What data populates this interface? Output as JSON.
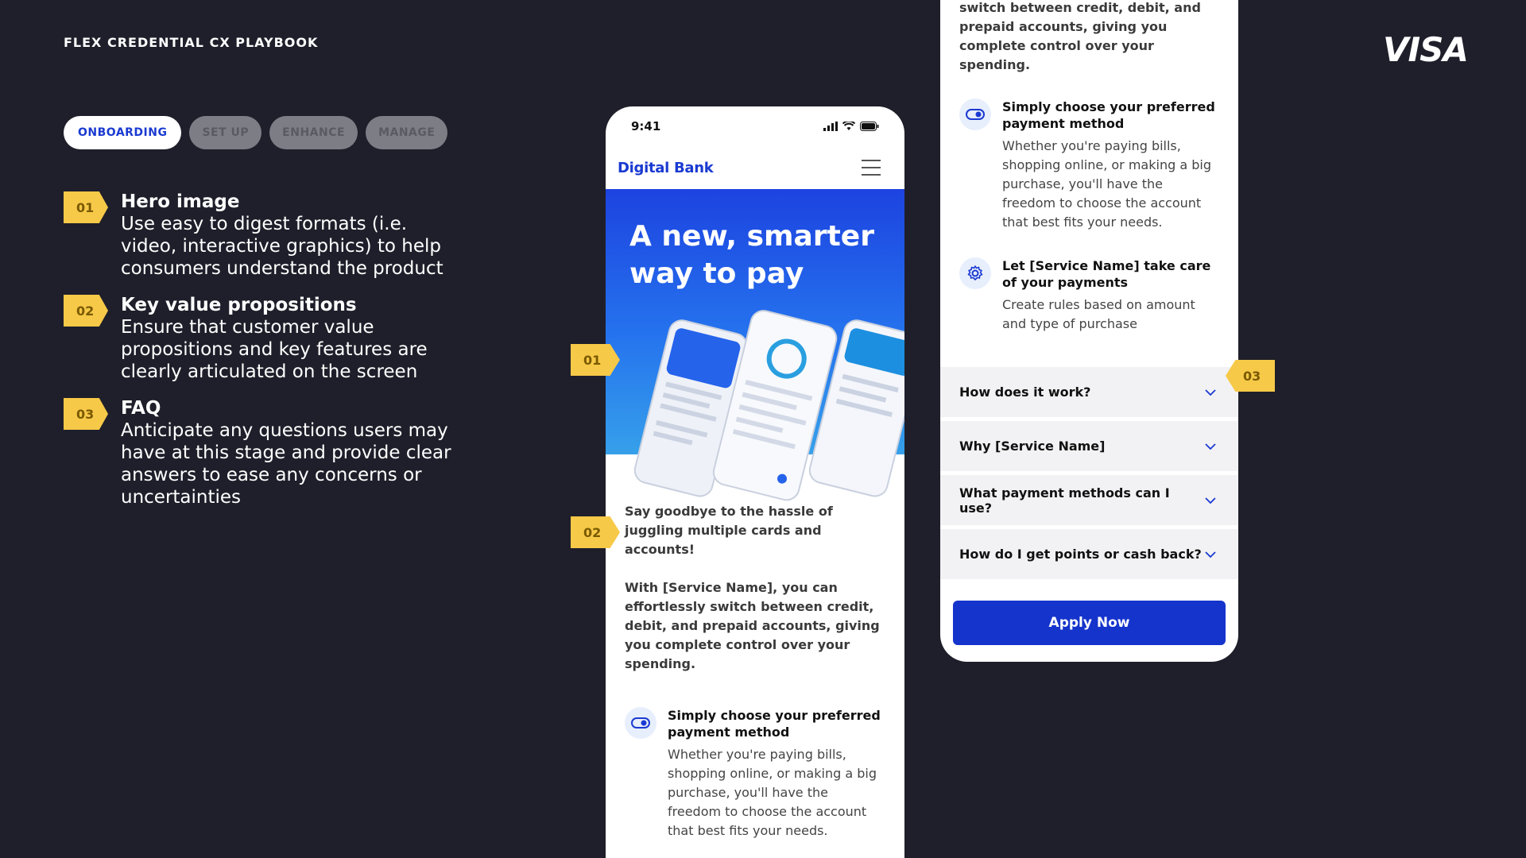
{
  "header": {
    "title": "FLEX CREDENTIAL CX PLAYBOOK",
    "logo": "VISA"
  },
  "tabs": [
    {
      "label": "ONBOARDING",
      "active": true
    },
    {
      "label": "SET UP",
      "active": false
    },
    {
      "label": "ENHANCE",
      "active": false
    },
    {
      "label": "MANAGE",
      "active": false
    }
  ],
  "points": [
    {
      "num": "01",
      "title": "Hero image",
      "desc": "Use easy to digest formats (i.e. video, interactive graphics) to help consumers understand the product"
    },
    {
      "num": "02",
      "title": "Key value propositions",
      "desc": "Ensure that customer value propositions and key features are clearly articulated on the screen"
    },
    {
      "num": "03",
      "title": "FAQ",
      "desc": "Anticipate any questions users may have at this stage and provide clear answers to ease any concerns or uncertainties"
    }
  ],
  "callouts": {
    "c1": "01",
    "c2": "02",
    "c3": "03"
  },
  "phone1": {
    "time": "9:41",
    "bank_name": "Digital Bank",
    "hero_title_line1": "A new, smarter",
    "hero_title_line2": "way to pay",
    "intro": "Say goodbye to the hassle of juggling multiple cards and accounts!",
    "body": "With [Service Name], you can effortlessly switch between credit, debit, and prepaid accounts, giving you complete control over your spending.",
    "feature1_title": "Simply choose your preferred payment method",
    "feature1_desc": "Whether you're paying bills, shopping online, or making a big purchase, you'll have the freedom to choose the account that best fits your needs."
  },
  "phone2": {
    "intro_partial": "switch between credit, debit, and prepaid accounts, giving you complete control over your spending.",
    "feature1_title": "Simply choose your preferred payment method",
    "feature1_desc": "Whether you're paying bills, shopping online, or making a big purchase, you'll have the freedom to choose the account that best fits your needs.",
    "feature2_title": "Let [Service Name] take care of your payments",
    "feature2_desc": "Create rules based on amount and type of purchase",
    "faq": [
      "How does it work?",
      "Why [Service Name]",
      "What payment methods can I use?",
      "How do I get points or cash back?"
    ],
    "apply_label": "Apply Now"
  },
  "colors": {
    "background": "#1f1f2b",
    "accent_blue": "#1a3ad1",
    "badge_yellow": "#f7c948"
  }
}
